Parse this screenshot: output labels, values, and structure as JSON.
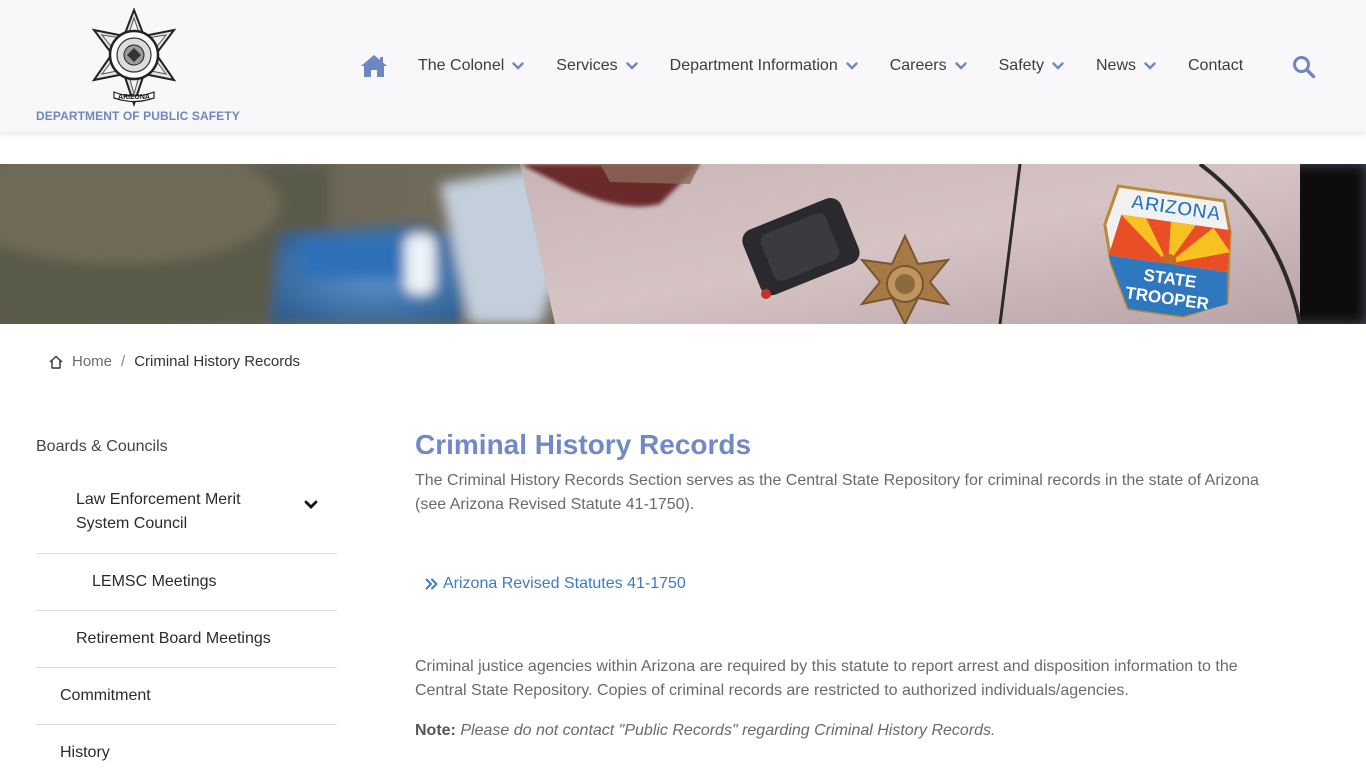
{
  "site": {
    "logo_text": "DEPARTMENT OF PUBLIC SAFETY",
    "badge_top_text": "DEPARTMENT OF PUBLIC SAFETY",
    "badge_bottom_text": "ARIZONA",
    "badge_inner_text": "STATE TROOPER"
  },
  "nav": {
    "home_icon": "home-icon",
    "items": [
      {
        "label": "The Colonel",
        "has_dropdown": true
      },
      {
        "label": "Services",
        "has_dropdown": true
      },
      {
        "label": "Department Information",
        "has_dropdown": true
      },
      {
        "label": "Careers",
        "has_dropdown": true
      },
      {
        "label": "Safety",
        "has_dropdown": true
      },
      {
        "label": "News",
        "has_dropdown": true
      },
      {
        "label": "Contact",
        "has_dropdown": false
      }
    ],
    "search_icon": "search-icon"
  },
  "banner": {
    "patch_top": "ARIZONA",
    "patch_line1": "STATE",
    "patch_line2": "TROOPER"
  },
  "breadcrumb": {
    "home": "Home",
    "separator": "/",
    "current": "Criminal History Records"
  },
  "sidebar": {
    "heading": "Boards & Councils",
    "items": [
      {
        "label": "Law Enforcement Merit System Council",
        "expandable": true
      },
      {
        "label": "LEMSC Meetings"
      },
      {
        "label": "Retirement Board Meetings"
      },
      {
        "label": "Commitment"
      },
      {
        "label": "History"
      }
    ]
  },
  "main": {
    "title": "Criminal History Records",
    "intro": "The Criminal History Records Section serves as the Central State Repository for criminal records in the state of Arizona (see Arizona Revised Statute 41-1750).",
    "link_label": "Arizona Revised Statutes 41-1750",
    "body": "Criminal justice agencies within Arizona are required by this statute to report arrest and disposition information to the Central State Repository. Copies of criminal records are restricted to authorized individuals/agencies.",
    "note_label": "Note:",
    "note_text": "Please do not contact \"Public Records\" regarding Criminal History Records."
  },
  "colors": {
    "accent": "#7289c7",
    "link": "#3f7ac4",
    "nav_icon": "#6e86c2"
  }
}
